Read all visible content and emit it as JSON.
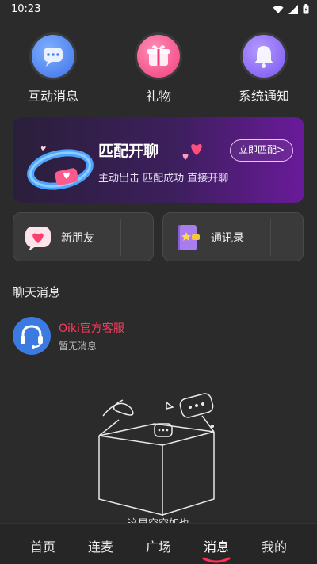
{
  "status_bar": {
    "time": "10:23"
  },
  "quick_actions": [
    {
      "label": "互动消息",
      "icon": "chat-bubble-icon",
      "color": "#4a7ff0"
    },
    {
      "label": "礼物",
      "icon": "gift-icon",
      "color": "#ff4d8d"
    },
    {
      "label": "系统通知",
      "icon": "bell-icon",
      "color": "#8a64f5"
    }
  ],
  "banner": {
    "title": "匹配开聊",
    "subtitle": "主动出击 匹配成功 直接开聊",
    "cta": "立即匹配>"
  },
  "cards": [
    {
      "label": "新朋友",
      "icon": "heart-chat-icon"
    },
    {
      "label": "通讯录",
      "icon": "address-book-icon"
    }
  ],
  "chat_section": {
    "title": "聊天消息"
  },
  "chats": [
    {
      "name": "Oiki官方客服",
      "preview": "暂无消息",
      "name_color": "#ff3b5c"
    }
  ],
  "empty_state": {
    "text": "这里空空如也"
  },
  "tabbar": {
    "tabs": [
      "首页",
      "连麦",
      "广场",
      "消息",
      "我的"
    ],
    "active_index": 3,
    "accent": "#ff2f5a"
  }
}
